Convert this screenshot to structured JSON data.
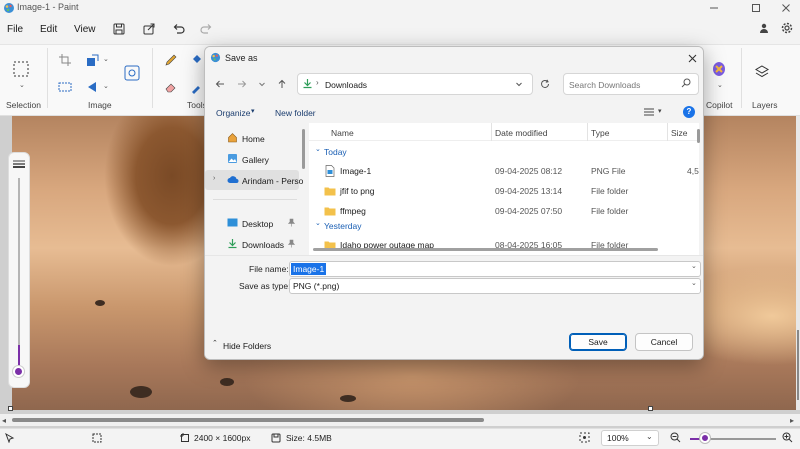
{
  "window": {
    "title": "Image-1 - Paint"
  },
  "menu": {
    "file": "File",
    "edit": "Edit",
    "view": "View"
  },
  "ribbon": {
    "groups": {
      "selection": "Selection",
      "image": "Image",
      "tools": "Tools",
      "copilot": "Copilot",
      "layers": "Layers"
    }
  },
  "dialog": {
    "title": "Save as",
    "address": "Downloads",
    "search_placeholder": "Search Downloads",
    "organize": "Organize",
    "new_folder": "New folder",
    "nav_items": [
      {
        "label": "Home"
      },
      {
        "label": "Gallery"
      },
      {
        "label": "Arindam - Perso"
      },
      {
        "label": "Desktop"
      },
      {
        "label": "Downloads"
      }
    ],
    "columns": {
      "name": "Name",
      "date": "Date modified",
      "type": "Type",
      "size": "Size"
    },
    "groups": {
      "today": "Today",
      "yesterday": "Yesterday"
    },
    "files": [
      {
        "name": "Image-1",
        "date": "09-04-2025 08:12",
        "type": "PNG File",
        "size": "4,5"
      },
      {
        "name": "jfif to png",
        "date": "09-04-2025 13:14",
        "type": "File folder",
        "size": ""
      },
      {
        "name": "ffmpeg",
        "date": "09-04-2025 07:50",
        "type": "File folder",
        "size": ""
      },
      {
        "name": "Idaho power outage map",
        "date": "08-04-2025 16:05",
        "type": "File folder",
        "size": ""
      }
    ],
    "file_name_label": "File name:",
    "file_name_value": "Image-1",
    "save_type_label": "Save as type:",
    "save_type_value": "PNG (*.png)",
    "hide_folders": "Hide Folders",
    "save": "Save",
    "cancel": "Cancel"
  },
  "status": {
    "dimensions": "2400 × 1600px",
    "size": "Size: 4.5MB",
    "zoom": "100%"
  },
  "colors": {
    "accent": "#005fb8",
    "purple": "#7b2fa8"
  }
}
